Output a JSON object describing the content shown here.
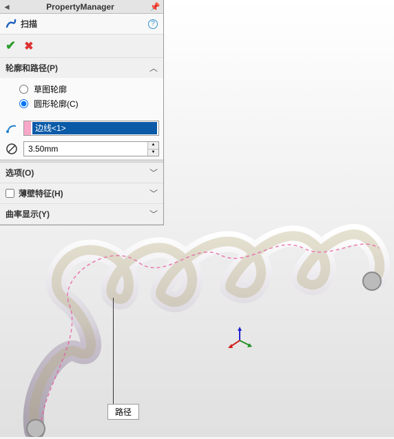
{
  "header": {
    "title": "PropertyManager"
  },
  "feature": {
    "name": "扫描"
  },
  "sections": {
    "profile_path": {
      "title": "轮廓和路径(P)",
      "radio_sketch": "草图轮廓",
      "radio_circle": "圆形轮廓(C)",
      "selected_radio": "circle",
      "path_selection": "边线<1>",
      "diameter_value": "3.50mm"
    },
    "options": {
      "title": "选项(O)"
    },
    "thin": {
      "title": "薄壁特征(H)"
    },
    "curvature": {
      "title": "曲率显示(Y)"
    }
  },
  "callout": {
    "label": "路径"
  }
}
